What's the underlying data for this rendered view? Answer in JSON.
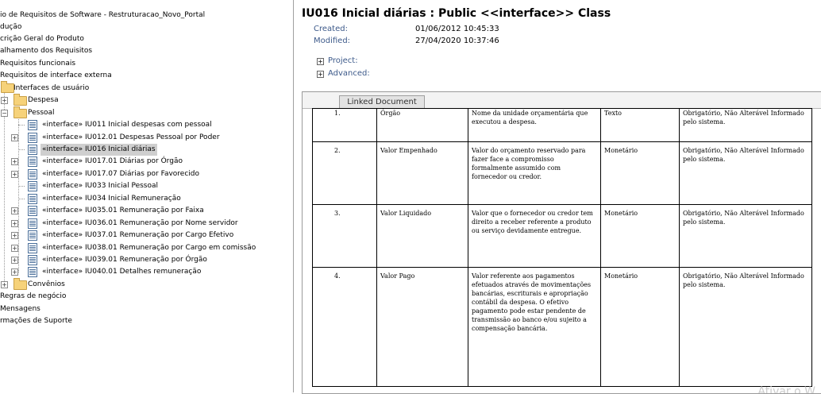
{
  "tree": {
    "items": [
      {
        "label": "io de Requisitos de Software - Restruturacao_Novo_Portal"
      },
      {
        "label": "dução"
      },
      {
        "label": "crição Geral do Produto"
      },
      {
        "label": "alhamento dos Requisitos"
      },
      {
        "label": "Requisitos funcionais"
      },
      {
        "label": "Requisitos de interface externa"
      },
      {
        "label": "Interfaces de usuário"
      },
      {
        "label": "Despesa"
      },
      {
        "label": "Pessoal"
      },
      {
        "label": "«interface» IU011 Inicial despesas com pessoal"
      },
      {
        "label": "«interface» IU012.01 Despesas Pessoal por Poder"
      },
      {
        "label": "«interface» IU016 Inicial diárias"
      },
      {
        "label": "«interface» IU017.01 Diárias por Órgão"
      },
      {
        "label": "«interface» IU017.07 Diárias por Favorecido"
      },
      {
        "label": "«interface» IU033 Inicial Pessoal"
      },
      {
        "label": "«interface» IU034 Inicial Remuneração"
      },
      {
        "label": "«interface» IU035.01 Remuneração por Faixa"
      },
      {
        "label": "«interface» IU036.01 Remuneração por Nome servidor"
      },
      {
        "label": "«interface» IU037.01 Remuneração por Cargo Efetivo"
      },
      {
        "label": "«interface» IU038.01 Remuneração por Cargo em comissão"
      },
      {
        "label": "«interface» IU039.01 Remuneração por Órgão"
      },
      {
        "label": "«interface» IU040.01 Detalhes remuneração"
      },
      {
        "label": "Convênios"
      },
      {
        "label": "Regras de negócio"
      },
      {
        "label": "Mensagens"
      },
      {
        "label": "rmações de Suporte"
      }
    ]
  },
  "detail": {
    "title": "IU016 Inicial diárias : Public <<interface>> Class",
    "created_label": "Created:",
    "created_value": "01/06/2012 10:45:33",
    "modified_label": "Modified:",
    "modified_value": "27/04/2020 10:37:46",
    "project_label": "Project:",
    "advanced_label": "Advanced:",
    "linked_tab": "Linked Document"
  },
  "table": {
    "rows": [
      {
        "num": "1.",
        "name": "Órgão",
        "desc": "Nome da unidade orçamentária que executou a despesa.",
        "type": "Texto",
        "rule": "Obrigatório, Não Alterável Informado pelo sistema."
      },
      {
        "num": "2.",
        "name": "Valor Empenhado",
        "desc": "Valor do orçamento reservado para fazer face a compromisso formalmente assumido com fornecedor ou credor.",
        "type": "Monetário",
        "rule": "Obrigatório, Não Alterável Informado pelo sistema."
      },
      {
        "num": "3.",
        "name": "Valor Liquidado",
        "desc": "Valor que o fornecedor ou credor tem direito a receber referente a produto ou serviço devidamente entregue.",
        "type": "Monetário",
        "rule": "Obrigatório, Não Alterável Informado pelo sistema."
      },
      {
        "num": "4.",
        "name": "Valor Pago",
        "desc": "Valor referente aos pagamentos efetuados através de movimentações bancárias, escriturais e apropriação contábil da despesa. O efetivo pagamento pode estar pendente de transmissão ao banco e/ou sujeito a compensação bancária.",
        "type": "Monetário",
        "rule": "Obrigatório, Não Alterável Informado pelo sistema."
      }
    ]
  },
  "watermark": "Ativar o W"
}
